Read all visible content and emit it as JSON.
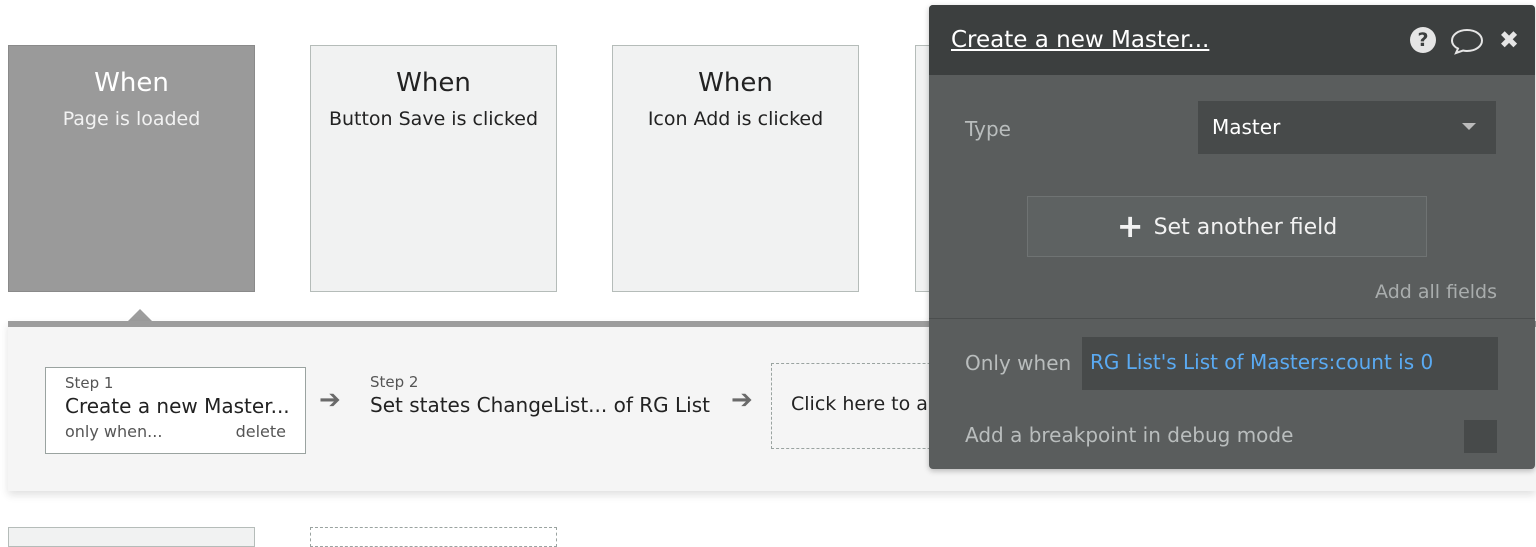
{
  "events": [
    {
      "when": "When",
      "description": "Page is loaded",
      "selected": true
    },
    {
      "when": "When",
      "description": "Button Save is clicked",
      "selected": false
    },
    {
      "when": "When",
      "description": "Icon Add is clicked",
      "selected": false
    }
  ],
  "workflow": {
    "steps": [
      {
        "number": "Step 1",
        "title": "Create a new Master...",
        "only_when": "only when...",
        "delete": "delete"
      },
      {
        "number": "Step 2",
        "title": "Set states ChangeList... of RG List"
      }
    ],
    "add_step_label": "Click here to a"
  },
  "panel": {
    "title": "Create a new Master...",
    "type_label": "Type",
    "type_value": "Master",
    "set_field_label": "Set another field",
    "add_all_fields": "Add all fields",
    "only_when_label": "Only when",
    "only_when_value": "RG List's List of Masters:count is 0",
    "breakpoint_label": "Add a breakpoint in debug mode",
    "icons": {
      "help": "?",
      "comment": "comment-icon",
      "close": "close-icon"
    }
  },
  "colors": {
    "selected_card": "#9a9a9a",
    "panel_bg": "#5a5d5d",
    "panel_header": "#3c3f3f",
    "link_blue": "#5aaaf2"
  }
}
